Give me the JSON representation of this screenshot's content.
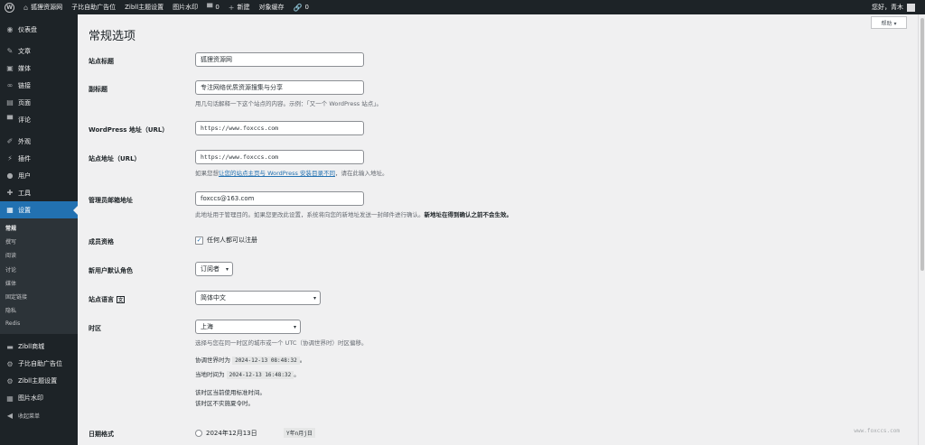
{
  "adminbar": {
    "site_name": "狐狸资源网",
    "ad": "子比自助广告位",
    "theme": "Zibll主题设置",
    "watermark": "图片水印",
    "comments": "0",
    "new": "新建",
    "cache": "对象缓存",
    "links": "0",
    "greeting": "您好，青木"
  },
  "sidebar": {
    "items": [
      {
        "label": "仪表盘",
        "icon": "dashboard-icon"
      },
      {
        "label": "文章",
        "icon": "pin-icon"
      },
      {
        "label": "媒体",
        "icon": "media-icon"
      },
      {
        "label": "链接",
        "icon": "link-icon"
      },
      {
        "label": "页面",
        "icon": "page-icon"
      },
      {
        "label": "评论",
        "icon": "comment-icon"
      },
      {
        "label": "外观",
        "icon": "brush-icon"
      },
      {
        "label": "插件",
        "icon": "plugin-icon"
      },
      {
        "label": "用户",
        "icon": "user-icon"
      },
      {
        "label": "工具",
        "icon": "wrench-icon"
      },
      {
        "label": "设置",
        "icon": "settings-icon"
      }
    ],
    "submenu": [
      "常规",
      "撰写",
      "阅读",
      "讨论",
      "媒体",
      "固定链接",
      "隐私",
      "Redis"
    ],
    "extra": [
      {
        "label": "Zibll商城",
        "icon": "cart-icon"
      },
      {
        "label": "子比自助广告位",
        "icon": "gear-icon"
      },
      {
        "label": "Zibll主题设置",
        "icon": "gear-icon"
      },
      {
        "label": "图片水印",
        "icon": "image-icon"
      },
      {
        "label": "收起菜单",
        "icon": "collapse-icon"
      }
    ]
  },
  "help": "帮助 ▾",
  "title": "常规选项",
  "fields": {
    "site_title": {
      "label": "站点标题",
      "value": "狐狸资源网"
    },
    "tagline": {
      "label": "副标题",
      "value": "专注网络优质资源搜集与分享",
      "desc": "用几句话解释一下这个站点的内容。示例：「又一个 WordPress 站点」。"
    },
    "wp_url": {
      "label": "WordPress 地址（URL）",
      "value": "https://www.foxccs.com"
    },
    "site_url": {
      "label": "站点地址（URL）",
      "value": "https://www.foxccs.com",
      "desc_pre": "如果您想",
      "desc_link": "让您的站点主页与 WordPress 安装目录不同",
      "desc_post": "，请在此输入地址。"
    },
    "admin_email": {
      "label": "管理员邮箱地址",
      "value": "foxccs@163.com",
      "desc": "此地址用于管理目的。如果您更改此设置，系统将向您的新地址发送一封邮件进行确认。",
      "desc_bold": "新地址在得到确认之前不会生效。"
    },
    "membership": {
      "label": "成员资格",
      "checkbox": "任何人都可以注册"
    },
    "default_role": {
      "label": "新用户默认角色",
      "value": "订阅者"
    },
    "language": {
      "label": "站点语言",
      "value": "简体中文"
    },
    "timezone": {
      "label": "时区",
      "value": "上海",
      "desc": "选择与您在同一时区的城市或一个 UTC（协调世界时）时区偏移。"
    },
    "utc_time": {
      "prefix": "协调世界时为",
      "value": "2024-12-13 08:48:32"
    },
    "local_time": {
      "prefix": "当地时间为",
      "value": "2024-12-13 16:48:32"
    },
    "tz_note1": "该时区当前使用标准时间。",
    "tz_note2": "该时区不实施夏令时。",
    "date_format": {
      "label": "日期格式",
      "option": "2024年12月13日",
      "code": "Y年n月j日"
    }
  },
  "watermark_text": "www.foxccs.com"
}
